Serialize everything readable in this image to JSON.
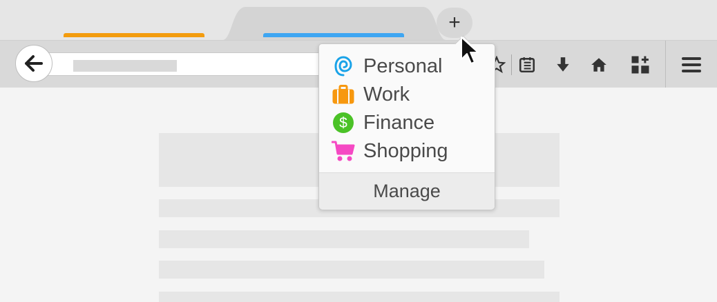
{
  "colors": {
    "tab_personal_line": "#f39c0e",
    "tab_active_line": "#3ea6f2",
    "personal_icon": "#1aa3e8",
    "work_icon": "#f7980f",
    "finance_icon": "#4bc227",
    "shopping_icon": "#f549c3"
  },
  "tabs": [
    {
      "icon": "tab-orange-indicator"
    },
    {
      "icon": "tab-blue-indicator",
      "active": true
    }
  ],
  "new_tab": {
    "label": "+"
  },
  "toolbar": {
    "icons": [
      "back-arrow-icon",
      "star-icon",
      "reading-list-icon",
      "download-icon",
      "home-icon",
      "add-ons-icon",
      "hamburger-menu-icon"
    ]
  },
  "container_menu": {
    "items": [
      {
        "label": "Personal",
        "icon": "fingerprint-icon"
      },
      {
        "label": "Work",
        "icon": "briefcase-icon"
      },
      {
        "label": "Finance",
        "icon": "dollar-icon"
      },
      {
        "label": "Shopping",
        "icon": "cart-icon"
      }
    ],
    "manage_label": "Manage"
  }
}
